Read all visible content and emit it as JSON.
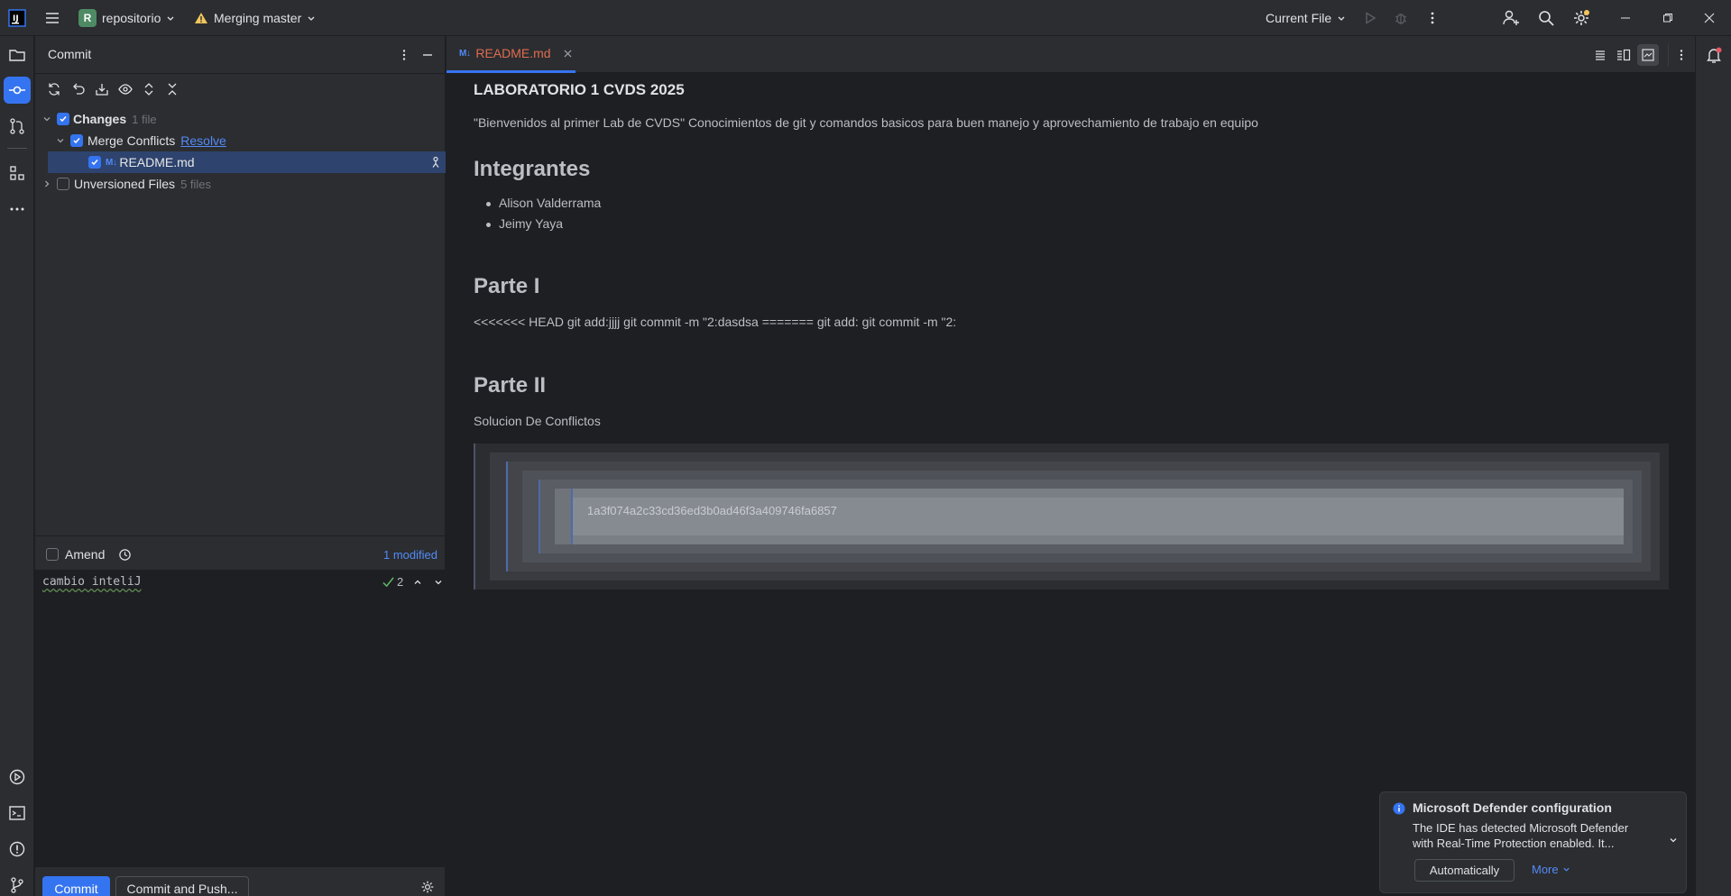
{
  "titlebar": {
    "project_badge": "R",
    "project_name": "repositorio",
    "branch_label": "Merging master",
    "run_config": "Current File"
  },
  "commit_panel": {
    "title": "Commit",
    "changes": {
      "label": "Changes",
      "count": "1 file"
    },
    "merge_conflicts": {
      "label": "Merge Conflicts",
      "resolve_link": "Resolve"
    },
    "file": {
      "name": "README.md",
      "icon_text": "M↓"
    },
    "unversioned": {
      "label": "Unversioned Files",
      "count": "5 files"
    },
    "amend_label": "Amend",
    "modified_link": "1 modified",
    "message": "cambio inteliJ",
    "check_count": "2",
    "commit_button": "Commit",
    "commit_push_button": "Commit and Push..."
  },
  "editor": {
    "tab": {
      "icon_text": "M↓",
      "label": "README.md"
    },
    "preview": {
      "title": "LABORATORIO 1 CVDS 2025",
      "intro": "\"Bienvenidos al primer Lab de CVDS\" Conocimientos de git y comandos basicos para buen manejo y aprovechamiento de trabajo en equipo",
      "section1_heading": "Integrantes",
      "members": [
        "Alison Valderrama",
        "Jeimy Yaya"
      ],
      "section2_heading": "Parte I",
      "section2_text": "<<<<<<< HEAD git add:jjjj git commit -m \"2:dasdsa ======= git add: git commit -m \"2:",
      "section3_heading": "Parte II",
      "section3_text": "Solucion De Conflictos",
      "quote_hash": "1a3f074a2c33cd36ed3b0ad46f3a409746fa6857"
    }
  },
  "notification": {
    "title": "Microsoft Defender configuration",
    "line1": "The IDE has detected Microsoft Defender",
    "line2": "with Real-Time Protection enabled. It...",
    "button": "Automatically",
    "more_link": "More"
  },
  "colors": {
    "accent": "#3574f0",
    "panel_bg": "#2b2d30",
    "editor_bg": "#1e1f22",
    "conflict_tab": "#e06c50",
    "selection": "#2e436e"
  }
}
